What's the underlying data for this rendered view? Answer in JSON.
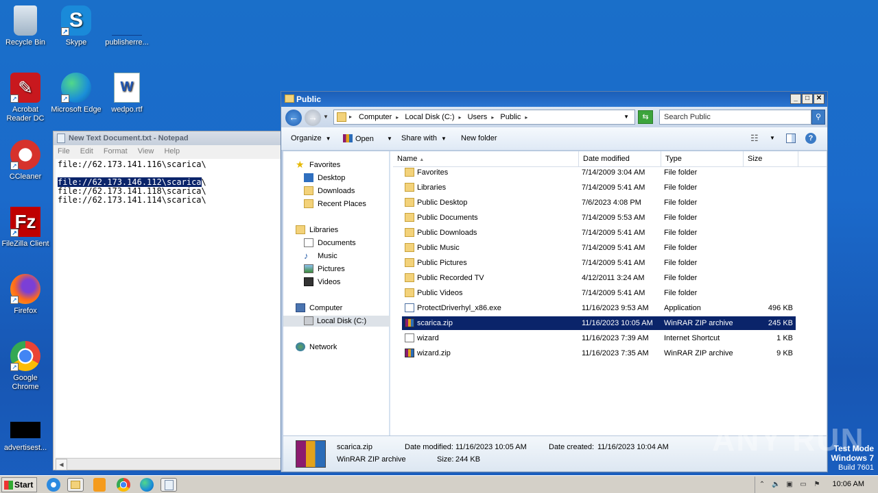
{
  "desktop": {
    "icons": [
      {
        "label": "Recycle Bin"
      },
      {
        "label": "Skype"
      },
      {
        "label": "publisherre..."
      },
      {
        "label": "Acrobat Reader DC"
      },
      {
        "label": "Microsoft Edge"
      },
      {
        "label": "wedpo.rtf"
      },
      {
        "label": "CCleaner"
      },
      {
        "label": "FileZilla Client"
      },
      {
        "label": "Firefox"
      },
      {
        "label": "Google Chrome"
      },
      {
        "label": "advertisest..."
      }
    ]
  },
  "notepad": {
    "title": "New Text Document.txt - Notepad",
    "menu": [
      "File",
      "Edit",
      "Format",
      "View",
      "Help"
    ],
    "lines": [
      "file://62.173.141.116\\scarica\\",
      "",
      "file://62.173.146.112\\scarica\\",
      "file://62.173.141.118\\scarica\\",
      "file://62.173.141.114\\scarica\\"
    ],
    "selected_text": "file://62.173.146.112\\scarica"
  },
  "explorer": {
    "title": "Public",
    "breadcrumb": [
      "Computer",
      "Local Disk (C:)",
      "Users",
      "Public"
    ],
    "search_placeholder": "Search Public",
    "toolbar": {
      "organize": "Organize",
      "open": "Open",
      "share_with": "Share with",
      "new_folder": "New folder"
    },
    "nav": {
      "favorites": "Favorites",
      "desktop": "Desktop",
      "downloads": "Downloads",
      "recent_places": "Recent Places",
      "libraries": "Libraries",
      "documents": "Documents",
      "music": "Music",
      "pictures": "Pictures",
      "videos": "Videos",
      "computer": "Computer",
      "local_disk": "Local Disk (C:)",
      "network": "Network"
    },
    "columns": {
      "name": "Name",
      "date": "Date modified",
      "type": "Type",
      "size": "Size"
    },
    "files": [
      {
        "name": "Favorites",
        "date": "7/14/2009 3:04 AM",
        "type": "File folder",
        "size": "",
        "icon": "folder"
      },
      {
        "name": "Libraries",
        "date": "7/14/2009 5:41 AM",
        "type": "File folder",
        "size": "",
        "icon": "folder"
      },
      {
        "name": "Public Desktop",
        "date": "7/6/2023 4:08 PM",
        "type": "File folder",
        "size": "",
        "icon": "folder"
      },
      {
        "name": "Public Documents",
        "date": "7/14/2009 5:53 AM",
        "type": "File folder",
        "size": "",
        "icon": "folder"
      },
      {
        "name": "Public Downloads",
        "date": "7/14/2009 5:41 AM",
        "type": "File folder",
        "size": "",
        "icon": "folder"
      },
      {
        "name": "Public Music",
        "date": "7/14/2009 5:41 AM",
        "type": "File folder",
        "size": "",
        "icon": "folder"
      },
      {
        "name": "Public Pictures",
        "date": "7/14/2009 5:41 AM",
        "type": "File folder",
        "size": "",
        "icon": "folder"
      },
      {
        "name": "Public Recorded TV",
        "date": "4/12/2011 3:24 AM",
        "type": "File folder",
        "size": "",
        "icon": "folder"
      },
      {
        "name": "Public Videos",
        "date": "7/14/2009 5:41 AM",
        "type": "File folder",
        "size": "",
        "icon": "folder"
      },
      {
        "name": "ProtectDriverhyl_x86.exe",
        "date": "11/16/2023 9:53 AM",
        "type": "Application",
        "size": "496 KB",
        "icon": "app"
      },
      {
        "name": "scarica.zip",
        "date": "11/16/2023 10:05 AM",
        "type": "WinRAR ZIP archive",
        "size": "245 KB",
        "icon": "rar",
        "selected": true
      },
      {
        "name": "wizard",
        "date": "11/16/2023 7:39 AM",
        "type": "Internet Shortcut",
        "size": "1 KB",
        "icon": "lnk"
      },
      {
        "name": "wizard.zip",
        "date": "11/16/2023 7:35 AM",
        "type": "WinRAR ZIP archive",
        "size": "9 KB",
        "icon": "rar"
      }
    ],
    "details": {
      "name": "scarica.zip",
      "type": "WinRAR ZIP archive",
      "modified_label": "Date modified:",
      "modified": "11/16/2023 10:05 AM",
      "size_label": "Size:",
      "size": "244 KB",
      "created_label": "Date created:",
      "created": "11/16/2023 10:04 AM"
    }
  },
  "watermark": "ANY RUN",
  "testmode": {
    "line1": "Test Mode",
    "line2": "Windows 7",
    "line3": "Build 7601"
  },
  "taskbar": {
    "start": "Start",
    "clock": "10:06 AM"
  }
}
